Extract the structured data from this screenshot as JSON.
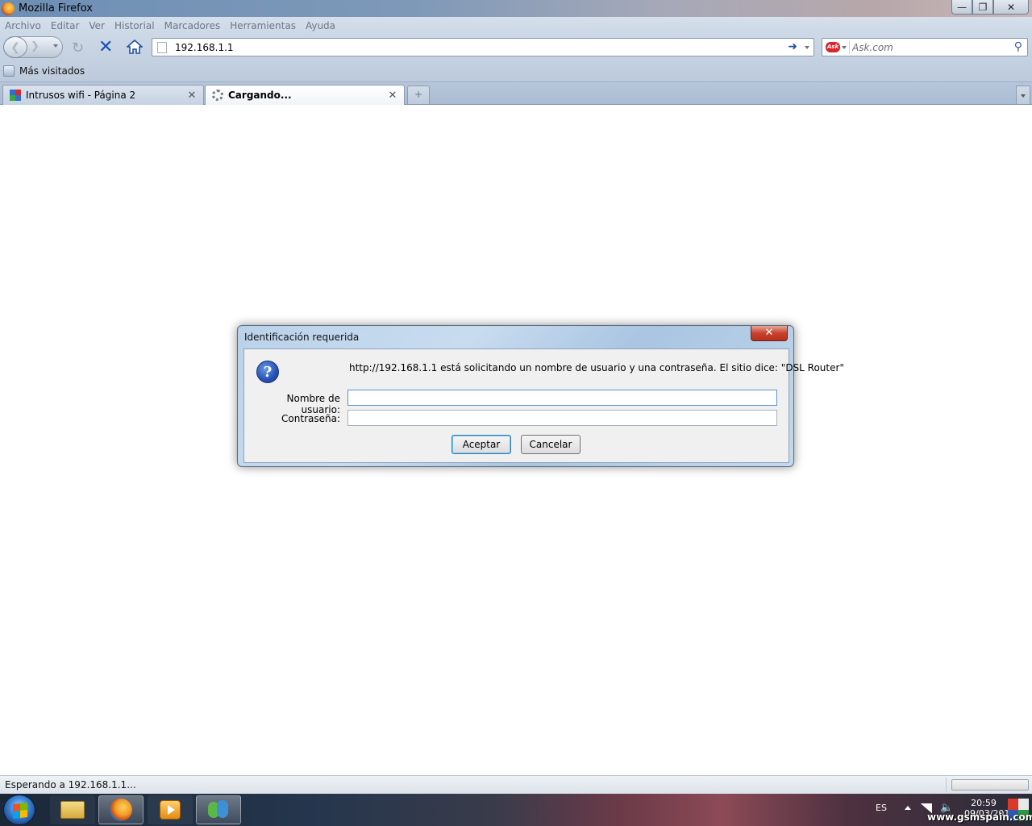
{
  "window": {
    "title": "Mozilla Firefox",
    "min_icon": "minimize-icon",
    "max_icon": "maximize-icon",
    "close_icon": "close-icon"
  },
  "menu": {
    "items": [
      "Archivo",
      "Editar",
      "Ver",
      "Historial",
      "Marcadores",
      "Herramientas",
      "Ayuda"
    ]
  },
  "toolbar": {
    "url": "192.168.1.1",
    "search_placeholder": "Ask.com",
    "search_engine_logo": "Ask"
  },
  "bookmarks": {
    "items": [
      "Más visitados"
    ]
  },
  "tabs": [
    {
      "label": "Intrusos wifi - Página 2",
      "active": false
    },
    {
      "label": "Cargando...",
      "active": true
    }
  ],
  "dialog": {
    "title": "Identificación requerida",
    "message": "http://192.168.1.1 está solicitando un nombre de usuario y una contraseña. El sitio dice: \"DSL Router\"",
    "username_label": "Nombre de usuario:",
    "password_label": "Contraseña:",
    "username_value": "",
    "password_value": "",
    "ok_label": "Aceptar",
    "cancel_label": "Cancelar"
  },
  "status": {
    "text": "Esperando a 192.168.1.1..."
  },
  "taskbar": {
    "language": "ES",
    "time": "20:59",
    "date": "09/03/2010"
  },
  "watermark": "www.gsmspain.com"
}
